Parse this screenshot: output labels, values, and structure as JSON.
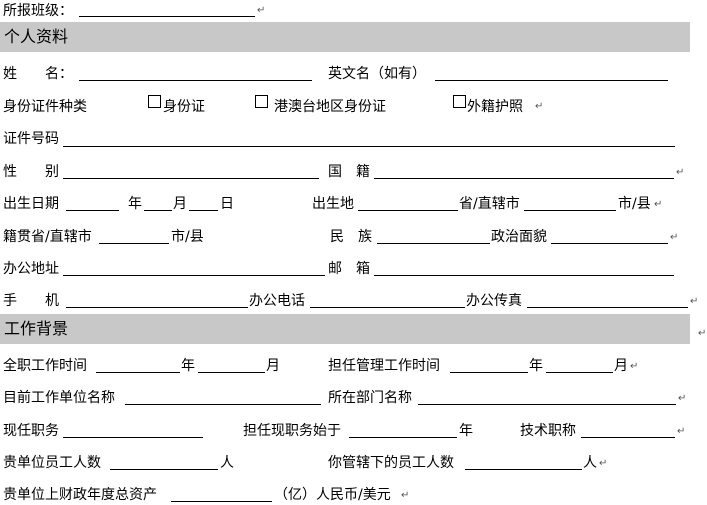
{
  "header": {
    "class_label": "所报班级："
  },
  "section_personal": {
    "title": "个人资料",
    "name_label": "姓　　名：",
    "english_name_label": "英文名（如有）",
    "id_type_label": "身份证件种类",
    "id_options": [
      "身份证",
      "港澳台地区身份证",
      "外籍护照"
    ],
    "id_number_label": "证件号码",
    "gender_label": "性　　别",
    "nationality_label": "国　籍",
    "birth_date_label": "出生日期",
    "year": "年",
    "month": "月",
    "day": "日",
    "birthplace_label": "出生地",
    "province_city": "省/直辖市",
    "city_county": "市/县",
    "native_place_label": "籍贯省/直辖市",
    "ethnicity_label": "民　族",
    "political_label": "政治面貌",
    "office_address_label": "办公地址",
    "email_label": "邮　箱",
    "mobile_label": "手　　机",
    "office_phone_label": "办公电话",
    "office_fax_label": "办公传真"
  },
  "section_work": {
    "title": "工作背景",
    "fulltime_label": "全职工作时间",
    "mgmt_time_label": "担任管理工作时间",
    "year": "年",
    "month": "月",
    "company_label": "目前工作单位名称",
    "department_label": "所在部门名称",
    "position_label": "现任职务",
    "position_since_label": "担任现职务始于",
    "tech_title_label": "技术职称",
    "employees_label": "贵单位员工人数",
    "person_unit": "人",
    "subordinates_label": "你管辖下的员工人数",
    "assets_label": "贵单位上财政年度总资产",
    "assets_unit": "（亿）人民币/美元"
  },
  "paragraph_mark": "↵"
}
